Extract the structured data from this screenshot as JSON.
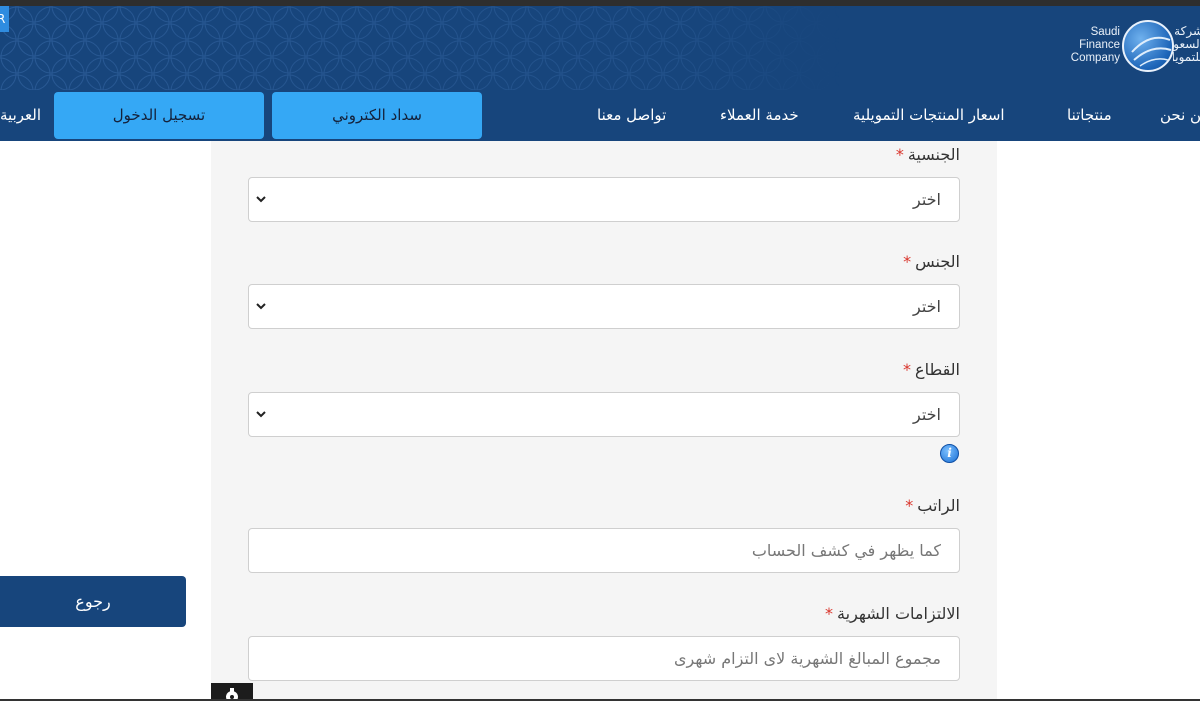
{
  "header": {
    "logo_en": [
      "Saudi",
      "Finance",
      "Company"
    ],
    "logo_ar": [
      "شركة",
      "السعودية",
      "للتمويل"
    ],
    "corner_glyph": "R"
  },
  "nav": {
    "items": [
      {
        "label": "من نحن"
      },
      {
        "label": "منتجاتنا"
      },
      {
        "label": "اسعار المنتجات التمويلية"
      },
      {
        "label": "خدمة العملاء"
      },
      {
        "label": "تواصل معنا"
      }
    ],
    "payment_button": "سداد الكتروني",
    "login_button": "تسجيل الدخول",
    "language": "العربية"
  },
  "form": {
    "nationality": {
      "label": "الجنسية",
      "required_mark": "*",
      "value": "اختر"
    },
    "gender": {
      "label": "الجنس",
      "required_mark": "*",
      "value": "اختر"
    },
    "sector": {
      "label": "القطاع",
      "required_mark": "*",
      "value": "اختر"
    },
    "salary": {
      "label": "الراتب",
      "required_mark": "*",
      "placeholder": "كما يظهر في كشف الحساب"
    },
    "obligations": {
      "label": "الالتزامات الشهرية",
      "required_mark": "*",
      "placeholder": "مجموع المبالغ الشهرية لاى التزام شهرى"
    },
    "info_glyph": "i"
  },
  "back_button": "رجوع",
  "colors": {
    "header_bg": "#17457c",
    "button_bg": "#35a8f5",
    "required": "#d9342b",
    "panel_bg": "#f5f5f5"
  },
  "icons": [
    "globe-logo-icon",
    "chevron-down-icon",
    "info-icon",
    "gear-icon"
  ]
}
